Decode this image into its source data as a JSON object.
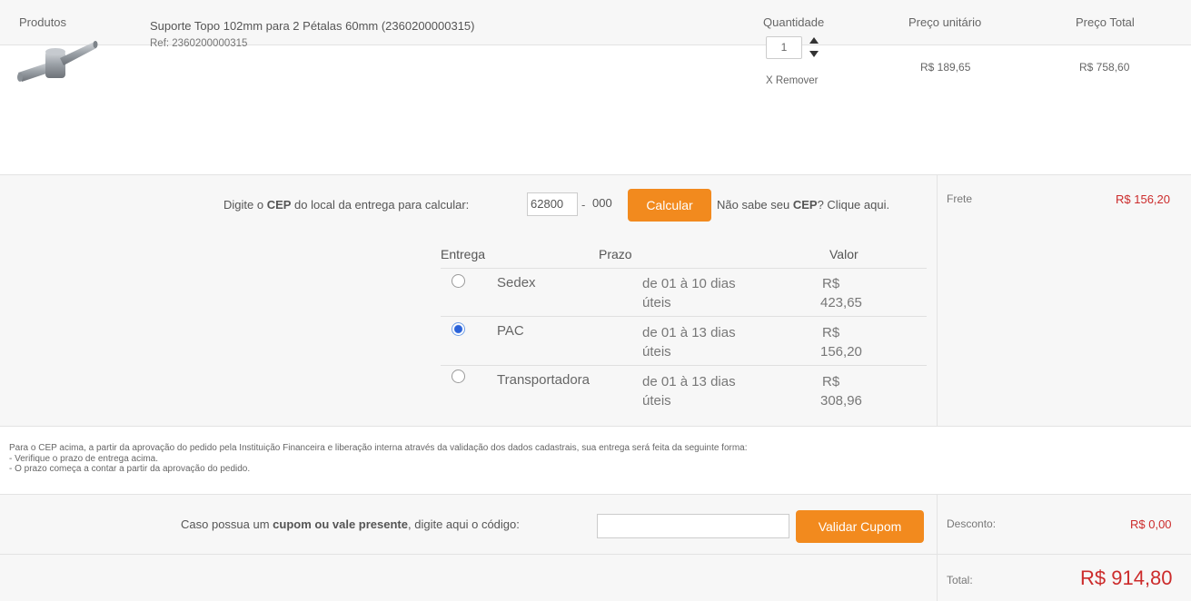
{
  "header": {
    "products": "Produtos",
    "quantity": "Quantidade",
    "unit_price": "Preço unitário",
    "total_price": "Preço Total"
  },
  "product": {
    "name": "Suporte Topo 102mm para 2 Pétalas 60mm (2360200000315)",
    "ref": "Ref: 2360200000315",
    "quantity": "1",
    "remove_label": "X Remover",
    "unit_price": "R$ 189,65",
    "total_price": "R$ 758,60"
  },
  "shipping": {
    "cep_prompt_pre": "Digite o ",
    "cep_prompt_bold": "CEP",
    "cep_prompt_post": " do local da entrega para calcular:",
    "cep_part1": "62800",
    "cep_dash": "-",
    "cep_part2": "000",
    "calc_button": "Calcular",
    "help_pre": "Não sabe seu ",
    "help_bold": "CEP",
    "help_post": "? Clique aqui.",
    "columns": {
      "delivery": "Entrega",
      "term": "Prazo",
      "value": "Valor"
    },
    "options": [
      {
        "name": "Sedex",
        "term_line1": "de 01 à 10 dias",
        "term_line2": "úteis",
        "value_line1": "R$",
        "value_line2": "423,65",
        "selected": false
      },
      {
        "name": "PAC",
        "term_line1": "de 01 à 13 dias",
        "term_line2": "úteis",
        "value_line1": "R$",
        "value_line2": "156,20",
        "selected": true
      },
      {
        "name": "Transportadora",
        "term_line1": "de 01 à 13 dias",
        "term_line2": "úteis",
        "value_line1": "R$",
        "value_line2": "308,96",
        "selected": false
      }
    ],
    "freight_label": "Frete",
    "freight_value": "R$ 156,20"
  },
  "info": {
    "line1": "Para o CEP acima, a partir da aprovação do pedido pela Instituição Financeira e liberação interna através da validação dos dados cadastrais, sua entrega será feita da seguinte forma:",
    "line2": "- Verifique o prazo de entrega acima.",
    "line3": "- O prazo começa a contar a partir da aprovação do pedido."
  },
  "coupon": {
    "prompt_pre": "Caso possua um ",
    "prompt_bold": "cupom ou vale presente",
    "prompt_post": ", digite aqui o código:",
    "button": "Validar Cupom",
    "discount_label": "Desconto:",
    "discount_value": "R$ 0,00"
  },
  "total": {
    "label": "Total:",
    "value": "R$ 914,80"
  },
  "colors": {
    "accent_orange": "#f28a1e",
    "price_red": "#cc2b2b",
    "radio_blue": "#2a62d9"
  }
}
